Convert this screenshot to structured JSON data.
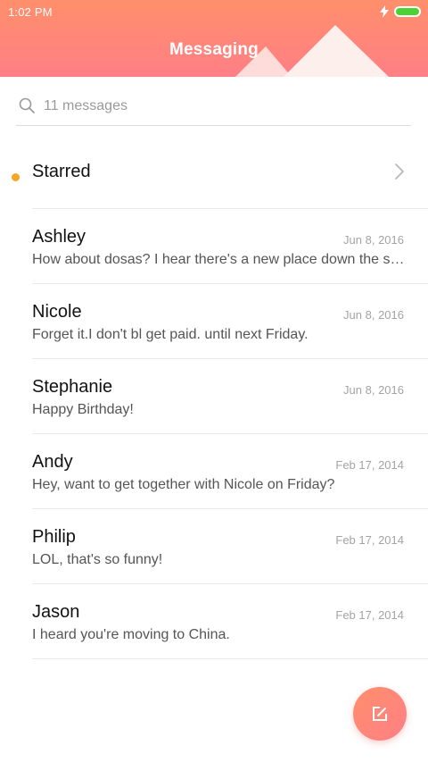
{
  "status_bar": {
    "time": "1:02 PM",
    "charging_icon": "lightning-bolt-icon",
    "battery_icon": "battery-icon",
    "battery_color": "#4cd137"
  },
  "header": {
    "title": "Messaging",
    "gradient_top": "#ff8f6b",
    "gradient_bottom": "#ff7f86"
  },
  "search": {
    "icon": "search-icon",
    "placeholder": "11 messages"
  },
  "starred": {
    "label": "Starred",
    "icon": "chevron-right-icon"
  },
  "messages": [
    {
      "sender": "Ashley",
      "date": "Jun 8, 2016",
      "preview": "How about dosas? I hear there's a new place down the st…",
      "unread": false
    },
    {
      "sender": "Nicole",
      "date": "Jun 8, 2016",
      "preview": "Forget it.I don't bl get paid. until next Friday.",
      "unread": false
    },
    {
      "sender": "Stephanie",
      "date": "Jun 8, 2016",
      "preview": "Happy Birthday!",
      "unread": true
    },
    {
      "sender": "Andy",
      "date": "Feb 17, 2014",
      "preview": "Hey, want to get together with Nicole on Friday?",
      "unread": false
    },
    {
      "sender": "Philip",
      "date": "Feb 17, 2014",
      "preview": "LOL, that's so funny!",
      "unread": false
    },
    {
      "sender": "Jason",
      "date": "Feb 17, 2014",
      "preview": "I heard you're moving to China.",
      "unread": false
    }
  ],
  "unread_dot_color": "#f5a623",
  "compose_button": {
    "icon": "compose-icon"
  }
}
